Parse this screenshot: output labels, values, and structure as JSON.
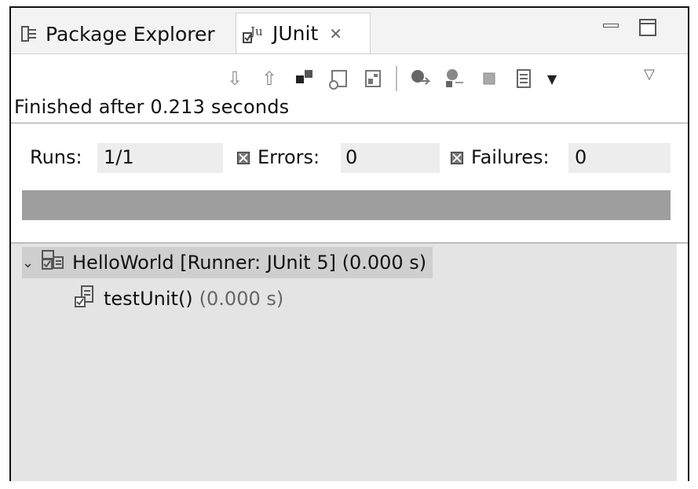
{
  "tabs": {
    "package_explorer": "Package Explorer",
    "junit": "JUnit",
    "junit_icon_letters": "Ju"
  },
  "status": {
    "finished": "Finished after 0.213 seconds"
  },
  "counters": {
    "runs_label": "Runs:",
    "runs_value": "1/1",
    "errors_label": "Errors:",
    "errors_value": "0",
    "failures_label": "Failures:",
    "failures_value": "0"
  },
  "progress": {
    "fraction": 1.0,
    "color": "#9e9e9e"
  },
  "tree": {
    "root": {
      "name": "HelloWorld [Runner: JUnit 5] (0.000 s)"
    },
    "children": [
      {
        "name": "testUnit()",
        "time": "(0.000 s)"
      }
    ]
  },
  "toolbar_icons": [
    "next-failure-icon",
    "previous-failure-icon",
    "show-failures-only-icon",
    "scroll-lock-icon",
    "show-skipped-only-icon",
    "rerun-test-icon",
    "rerun-failed-first-icon",
    "stop-icon",
    "test-run-history-icon",
    "history-dropdown-icon",
    "view-menu-icon"
  ]
}
